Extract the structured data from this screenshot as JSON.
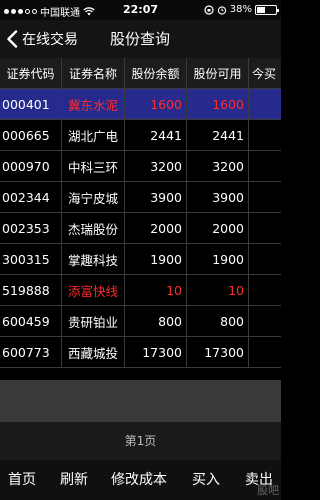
{
  "status": {
    "carrier": "中国联通",
    "time": "22:07",
    "battery": "38%",
    "battery_level": 0.38
  },
  "nav": {
    "back_label": "在线交易",
    "title": "股份查询"
  },
  "table": {
    "headers": [
      "证券代码",
      "证券名称",
      "股份余额",
      "股份可用",
      "今买"
    ],
    "rows": [
      {
        "code": "000401",
        "name": "冀东水泥",
        "balance": "1600",
        "available": "1600",
        "selected": true,
        "name_red": true,
        "values_red": true
      },
      {
        "code": "000665",
        "name": "湖北广电",
        "balance": "2441",
        "available": "2441"
      },
      {
        "code": "000970",
        "name": "中科三环",
        "balance": "3200",
        "available": "3200"
      },
      {
        "code": "002344",
        "name": "海宁皮城",
        "balance": "3900",
        "available": "3900"
      },
      {
        "code": "002353",
        "name": "杰瑞股份",
        "balance": "2000",
        "available": "2000"
      },
      {
        "code": "300315",
        "name": "掌趣科技",
        "balance": "1900",
        "available": "1900"
      },
      {
        "code": "519888",
        "name": "添富快线",
        "balance": "10",
        "available": "10",
        "name_red": true,
        "values_red": true
      },
      {
        "code": "600459",
        "name": "贵研铂业",
        "balance": "800",
        "available": "800"
      },
      {
        "code": "600773",
        "name": "西藏城投",
        "balance": "17300",
        "available": "17300"
      }
    ]
  },
  "pager": {
    "label": "第1页"
  },
  "toolbar": {
    "home": "首页",
    "refresh": "刷新",
    "edit_cost": "修改成本",
    "buy": "买入",
    "sell": "卖出"
  },
  "watermark": "股吧"
}
